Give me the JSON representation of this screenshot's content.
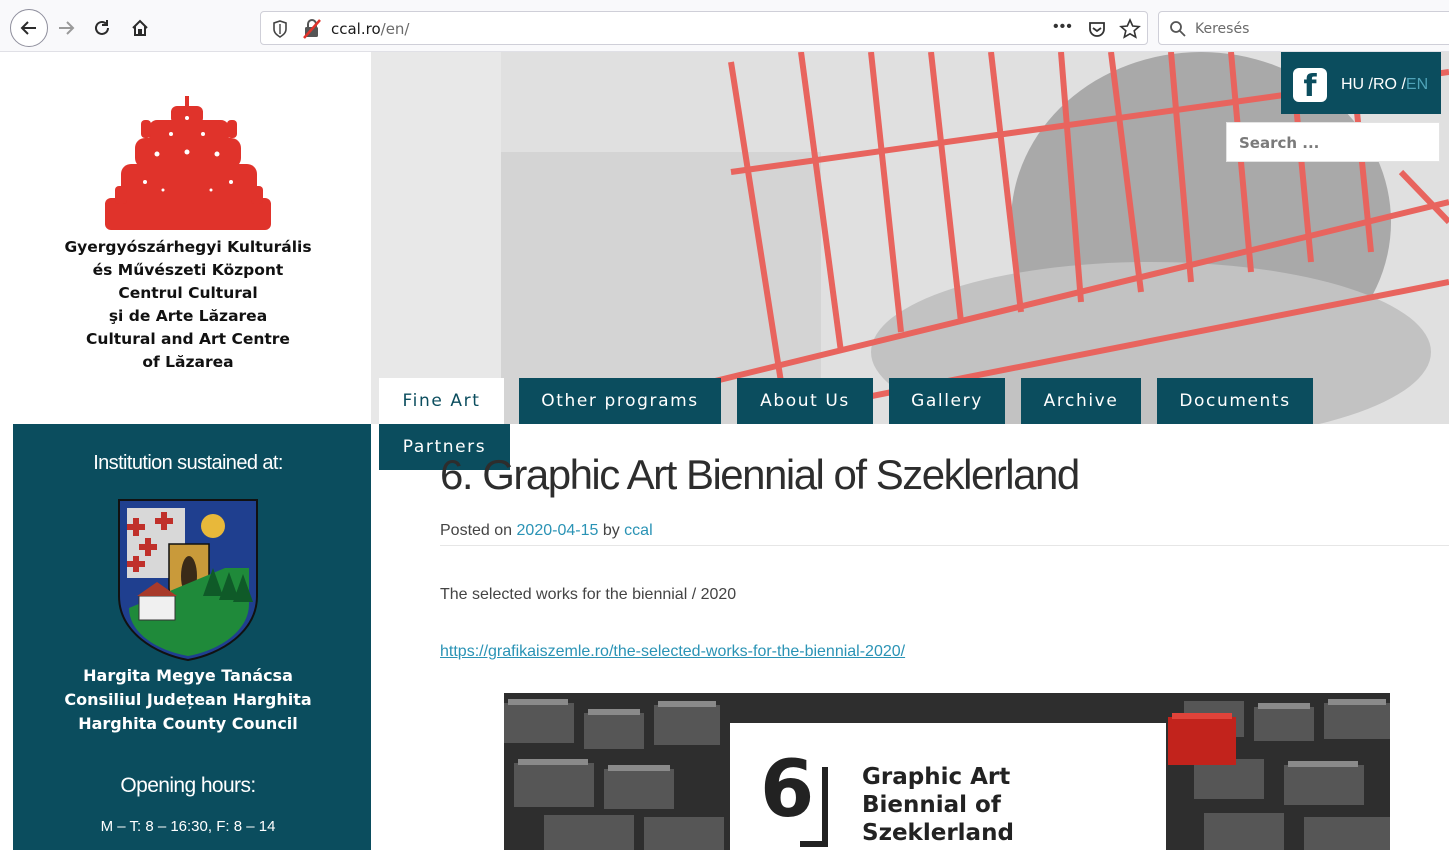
{
  "browser": {
    "url_domain": "ccal.ro",
    "url_path": "/en/",
    "overflow_glyph": "•••",
    "search_placeholder": "Keresés"
  },
  "brand": {
    "lines": [
      "Gyergyószárhegyi Kulturális",
      "és Művészeti Központ",
      "Centrul Cultural",
      "şi de Arte Lăzarea",
      "Cultural and Art Centre",
      "of Lăzarea"
    ]
  },
  "sidebar": {
    "sustained_label": "Institution sustained at:",
    "council_lines": [
      "Hargita Megye Tanácsa",
      "Consiliul Județean Harghita",
      "Harghita County Council"
    ],
    "opening_title": "Opening hours:",
    "opening_hours": "M – T: 8 – 16:30, F: 8 – 14"
  },
  "header": {
    "facebook_glyph": "f",
    "lang_hu": "HU",
    "lang_ro": "RO",
    "lang_en": "EN",
    "lang_sep": " /",
    "search_placeholder": "Search ..."
  },
  "nav": {
    "items": [
      {
        "label": "Fine Art",
        "active": true
      },
      {
        "label": "Other programs"
      },
      {
        "label": "About Us"
      },
      {
        "label": "Gallery"
      },
      {
        "label": "Archive"
      },
      {
        "label": "Documents"
      },
      {
        "label": "Partners"
      }
    ]
  },
  "post": {
    "title": "6. Graphic Art Biennial of Szeklerland",
    "meta_prefix": "Posted on",
    "date": "2020-04-15",
    "meta_by": "by",
    "author": "ccal",
    "text": "The selected works for the biennial / 2020",
    "link": "https://grafikaiszemle.ro/the-selected-works-for-the-biennial-2020/"
  },
  "poster": {
    "number": "6",
    "lines": [
      "Graphic Art",
      "Biennial of",
      "Szeklerland"
    ]
  },
  "colors": {
    "teal": "#0b4d5e",
    "link": "#2a93b5",
    "logo_red": "#e0332b",
    "hero_red": "#e8645e"
  }
}
